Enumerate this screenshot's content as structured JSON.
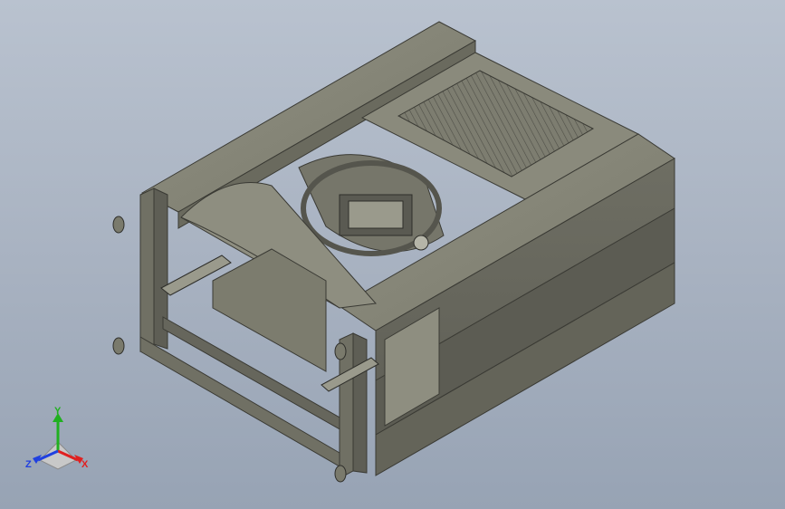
{
  "viewport": {
    "background_top": "#b9c2cf",
    "background_bottom": "#97a3b4",
    "model_color": "#808070"
  },
  "triad": {
    "x_label": "X",
    "y_label": "Y",
    "z_label": "Z",
    "x_color": "#e02020",
    "y_color": "#20b020",
    "z_color": "#2040e0"
  }
}
